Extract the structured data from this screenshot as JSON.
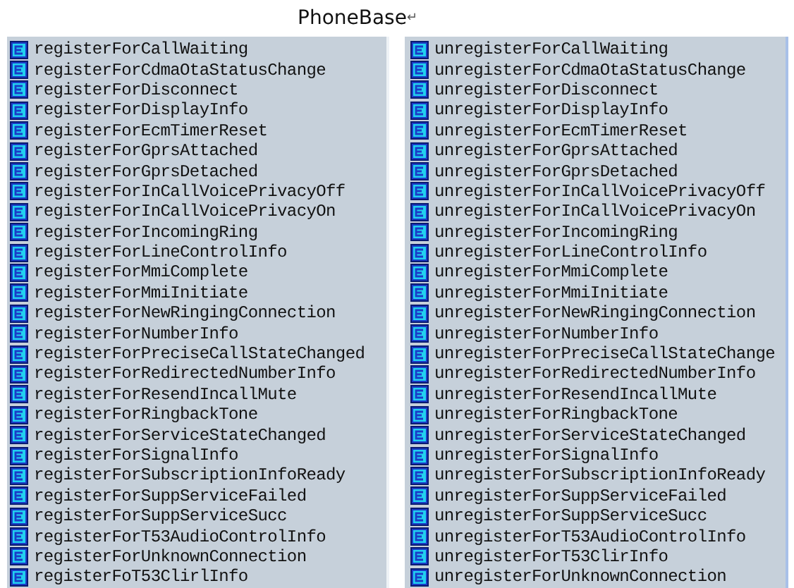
{
  "title": "PhoneBase",
  "paragraph_mark": "↵",
  "left_list": [
    "registerForCallWaiting",
    "registerForCdmaOtaStatusChange",
    "registerForDisconnect",
    "registerForDisplayInfo",
    "registerForEcmTimerReset",
    "registerForGprsAttached",
    "registerForGprsDetached",
    "registerForInCallVoicePrivacyOff",
    "registerForInCallVoicePrivacyOn",
    "registerForIncomingRing",
    "registerForLineControlInfo",
    "registerForMmiComplete",
    "registerForMmiInitiate",
    "registerForNewRingingConnection",
    "registerForNumberInfo",
    "registerForPreciseCallStateChanged",
    "registerForRedirectedNumberInfo",
    "registerForResendIncallMute",
    "registerForRingbackTone",
    "registerForServiceStateChanged",
    "registerForSignalInfo",
    "registerForSubscriptionInfoReady",
    "registerForSuppServiceFailed",
    "registerForSuppServiceSucc",
    "registerForT53AudioControlInfo",
    "registerForUnknownConnection",
    "registerFoT53ClirlInfo"
  ],
  "right_list": [
    "unregisterForCallWaiting",
    "unregisterForCdmaOtaStatusChange",
    "unregisterForDisconnect",
    "unregisterForDisplayInfo",
    "unregisterForEcmTimerReset",
    "unregisterForGprsAttached",
    "unregisterForGprsDetached",
    "unregisterForInCallVoicePrivacyOff",
    "unregisterForInCallVoicePrivacyOn",
    "unregisterForIncomingRing",
    "unregisterForLineControlInfo",
    "unregisterForMmiComplete",
    "unregisterForMmiInitiate",
    "unregisterForNewRingingConnection",
    "unregisterForNumberInfo",
    "unregisterForPreciseCallStateChange",
    "unregisterForRedirectedNumberInfo",
    "unregisterForResendIncallMute",
    "unregisterForRingbackTone",
    "unregisterForServiceStateChanged",
    "unregisterForSignalInfo",
    "unregisterForSubscriptionInfoReady",
    "unregisterForSuppServiceFailed",
    "unregisterForSuppServiceSucc",
    "unregisterForT53AudioControlInfo",
    "unregisterForT53ClirInfo",
    "unregisterForUnknownConnection"
  ]
}
